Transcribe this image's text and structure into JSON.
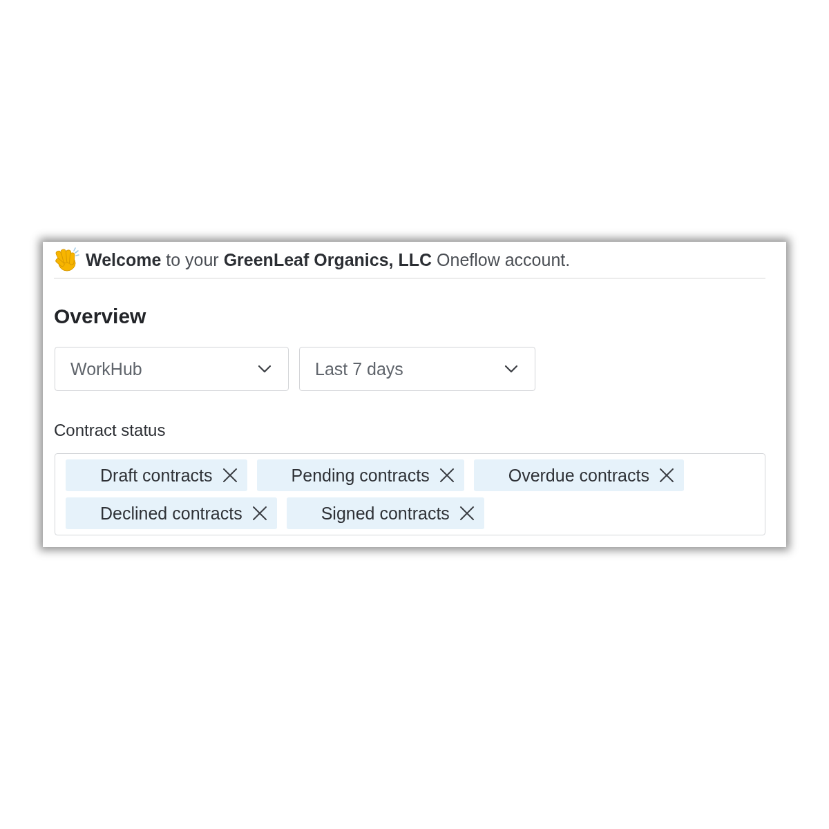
{
  "greeting": {
    "text": "**Welcome** to your **GreenLeaf Organics, LLC** Oneflow account."
  },
  "overview": {
    "title": "Overview",
    "filters": [
      {
        "value": "WorkHub"
      },
      {
        "value": "Last 7 days"
      }
    ]
  },
  "contract_status": {
    "label": "Contract status",
    "tags": [
      {
        "label": "Draft contracts"
      },
      {
        "label": "Pending contracts"
      },
      {
        "label": "Overdue contracts"
      },
      {
        "label": "Declined contracts"
      },
      {
        "label": "Signed contracts"
      }
    ]
  }
}
